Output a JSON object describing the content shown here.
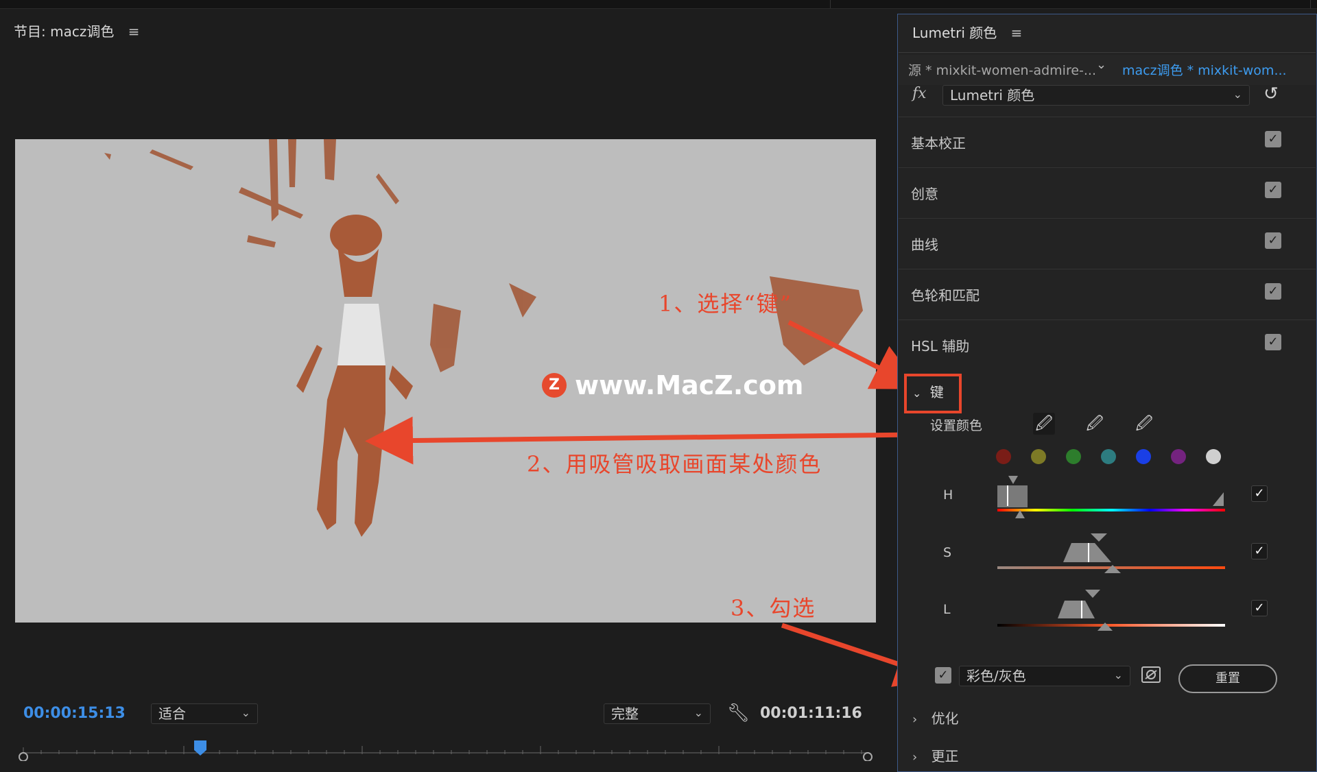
{
  "monitor": {
    "title": "节目: macz调色",
    "menu_icon": "≡",
    "current_time": "00:00:15:13",
    "zoom_select": "适合",
    "quality_select": "完整",
    "duration": "00:01:11:16",
    "watermark_logo": "Z",
    "watermark": "www.MacZ.com"
  },
  "annotations": {
    "step1": "1、选择“键”",
    "step2": "2、用吸管吸取画面某处颜色",
    "step3": "3、勾选",
    "color": "#e8462c"
  },
  "panel": {
    "title": "Lumetri 颜色",
    "menu_icon": "≡",
    "source_tab": "源 * mixkit-women-admire-...",
    "sequence_tab": "macz调色 * mixkit-wom...",
    "fx_label": "fx",
    "effect_select": "Lumetri 颜色",
    "sections": [
      {
        "label": "基本校正",
        "checked": true
      },
      {
        "label": "创意",
        "checked": true
      },
      {
        "label": "曲线",
        "checked": true
      },
      {
        "label": "色轮和匹配",
        "checked": true
      },
      {
        "label": "HSL 辅助",
        "checked": true
      }
    ],
    "key": {
      "label": "键",
      "set_color": "设置颜色",
      "swatches": [
        "#7a1d17",
        "#7d7a26",
        "#2d7d2c",
        "#2d7c80",
        "#1a3fe6",
        "#74237f",
        "#cfcfcf"
      ],
      "channels": [
        {
          "label": "H",
          "checked": true
        },
        {
          "label": "S",
          "checked": true
        },
        {
          "label": "L",
          "checked": true
        }
      ],
      "display_checked": true,
      "display_select": "彩色/灰色",
      "reset_button": "重置"
    },
    "subsections": [
      "优化",
      "更正"
    ]
  }
}
